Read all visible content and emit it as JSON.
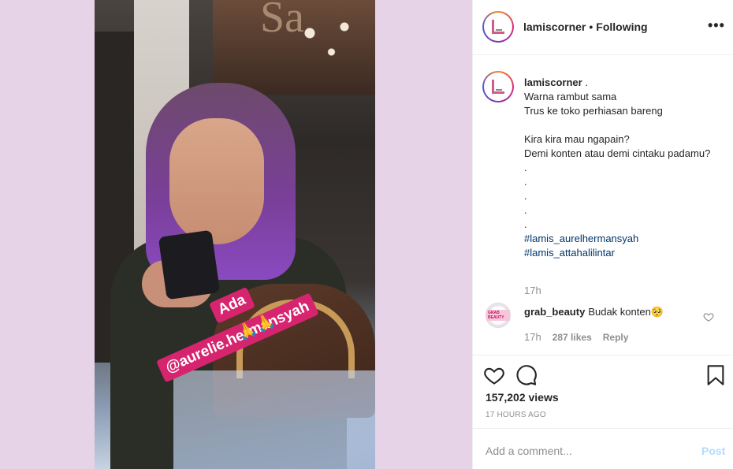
{
  "header": {
    "username": "lamiscorner",
    "separator": "•",
    "follow_status": "Following",
    "more_icon": "more-horizontal-icon"
  },
  "media": {
    "sticker_line1": "Ada",
    "sticker_line2": "@aurelie.hermansyah",
    "sticker_emoji": "🙏🙏"
  },
  "caption": {
    "username": "lamiscorner",
    "lines": [
      ".",
      "Warna rambut sama",
      "Trus ke toko perhiasan bareng",
      "",
      "Kira kira mau ngapain?",
      "Demi konten atau demi cintaku padamu?",
      ".",
      ".",
      ".",
      ".",
      "."
    ],
    "hashtags": [
      "#lamis_aurelhermansyah",
      "#lamis_attahalilintar"
    ],
    "time": "17h"
  },
  "comment": {
    "username": "grab_beauty",
    "avatar_text": "GRAB BEAUTY",
    "text": "Budak konten🥺",
    "time": "17h",
    "likes": "287 likes",
    "reply": "Reply"
  },
  "actions": {
    "like_icon": "heart-icon",
    "comment_icon": "comment-icon",
    "save_icon": "bookmark-icon",
    "views": "157,202 views",
    "posted": "17 HOURS AGO"
  },
  "add_comment": {
    "placeholder": "Add a comment...",
    "post_label": "Post"
  },
  "colors": {
    "background_left": "#e6d3e8",
    "sticker": "#d6246e",
    "hashtag": "#003569",
    "post_disabled": "#b3dbff"
  }
}
